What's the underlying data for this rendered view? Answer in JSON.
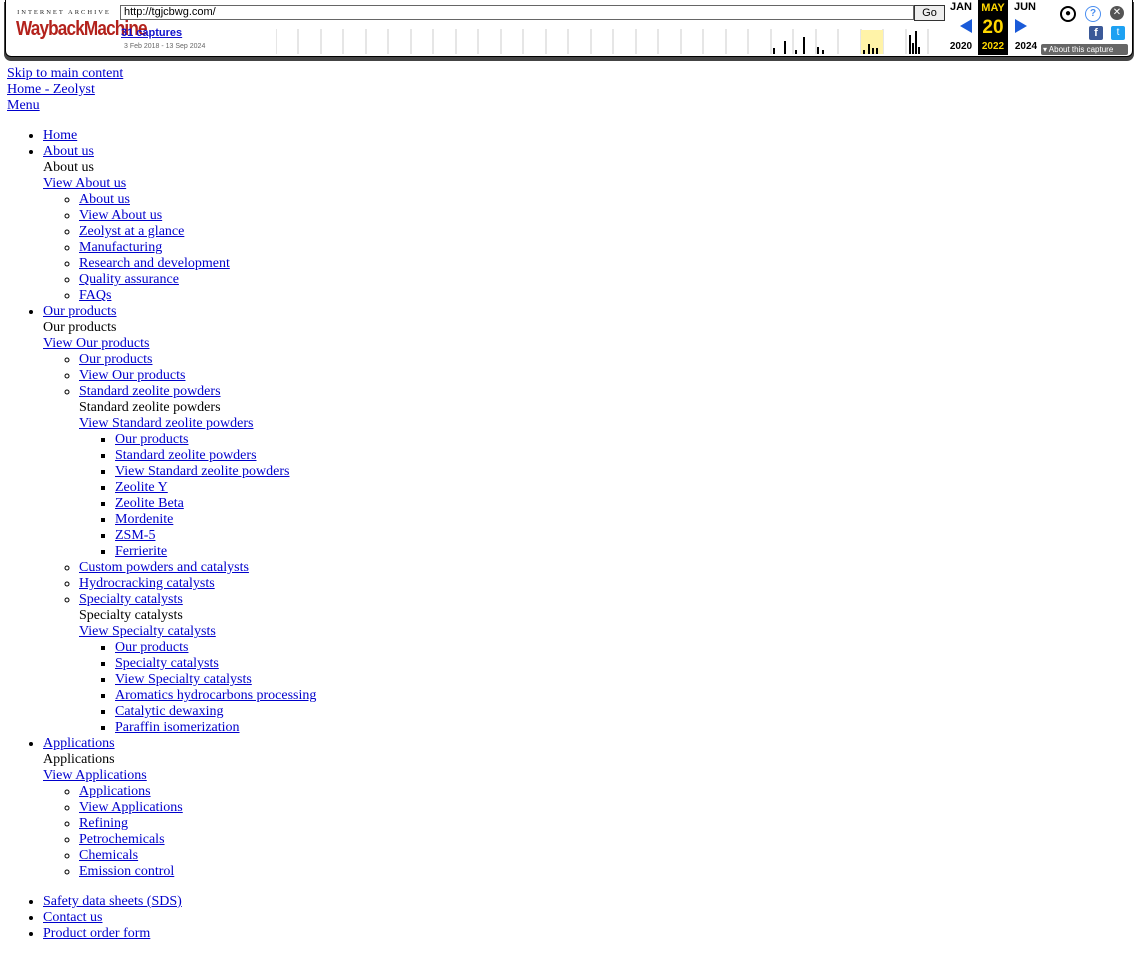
{
  "wayback": {
    "logo_top": "INTERNET ARCHIVE",
    "logo_main": "WaybackMachine",
    "url": "http://tgjcbwg.com/",
    "go": "Go",
    "captures": "31 captures",
    "range": "3 Feb 2018 - 13 Sep 2024",
    "prev_month": "JAN",
    "prev_year": "2020",
    "cur_month": "MAY",
    "cur_day": "20",
    "cur_year": "2022",
    "next_month": "JUN",
    "next_year": "2024",
    "about": "About this capture",
    "accent": "#ffd700",
    "logo_color": "#b3221c"
  },
  "skip_link": "Skip to main content",
  "home_link": "Home - Zeolyst",
  "menu_link": "Menu",
  "nav": {
    "home": "Home",
    "about": {
      "link": "About us",
      "title": "About us",
      "view": "View About us",
      "items": [
        "About us",
        "View About us",
        "Zeolyst at a glance",
        "Manufacturing",
        "Research and development",
        "Quality assurance",
        "FAQs"
      ]
    },
    "products": {
      "link": "Our products",
      "title": "Our products",
      "view": "View Our products",
      "items_before": [
        "Our products",
        "View Our products"
      ],
      "standard": {
        "link": "Standard zeolite powders",
        "title": "Standard zeolite powders",
        "view": "View Standard zeolite powders",
        "items": [
          "Our products",
          "Standard zeolite powders",
          "View Standard zeolite powders",
          "Zeolite Y",
          "Zeolite Beta",
          "Mordenite",
          "ZSM-5",
          "Ferrierite"
        ]
      },
      "items_middle": [
        "Custom powders and catalysts",
        "Hydrocracking catalysts"
      ],
      "specialty": {
        "link": "Specialty catalysts",
        "title": "Specialty catalysts",
        "view": "View Specialty catalysts",
        "items": [
          "Our products",
          "Specialty catalysts",
          "View Specialty catalysts",
          "Aromatics hydrocarbons processing",
          "Catalytic dewaxing",
          "Paraffin isomerization"
        ]
      }
    },
    "applications": {
      "link": "Applications",
      "title": "Applications",
      "view": "View Applications",
      "items": [
        "Applications",
        "View Applications",
        "Refining",
        "Petrochemicals",
        "Chemicals",
        "Emission control"
      ]
    }
  },
  "utility": [
    "Safety data sheets (SDS)",
    "Contact us",
    "Product order form"
  ]
}
